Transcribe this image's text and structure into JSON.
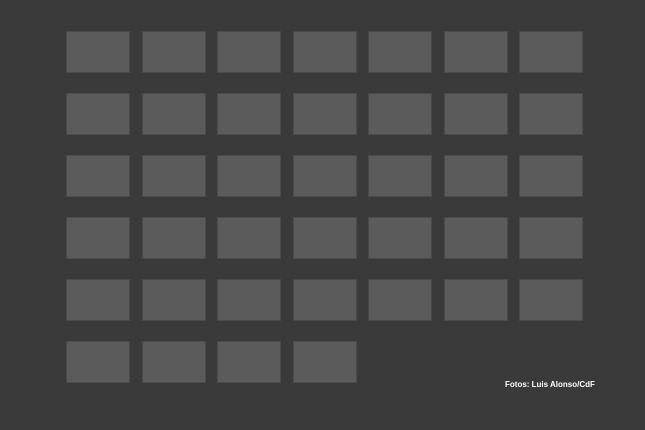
{
  "credit": "Fotos: Luis Alonso/CdF",
  "grid": {
    "rows": [
      [
        {
          "caption": "",
          "credit": ""
        },
        {
          "caption": "",
          "credit": ""
        },
        {
          "caption": "",
          "credit": ""
        },
        {
          "caption": "",
          "credit": ""
        },
        {
          "caption": "",
          "credit": ""
        },
        {
          "caption": "",
          "credit": ""
        },
        {
          "caption": "",
          "credit": ""
        }
      ],
      [
        {
          "caption": "",
          "credit": ""
        },
        {
          "caption": "",
          "credit": ""
        },
        {
          "caption": "",
          "credit": ""
        },
        {
          "caption": "",
          "credit": ""
        },
        {
          "caption": "",
          "credit": ""
        },
        {
          "caption": "",
          "credit": ""
        },
        {
          "caption": "",
          "credit": ""
        }
      ],
      [
        {
          "caption": "",
          "credit": ""
        },
        {
          "caption": "",
          "credit": ""
        },
        {
          "caption": "",
          "credit": ""
        },
        {
          "caption": "",
          "credit": ""
        },
        {
          "caption": "",
          "credit": ""
        },
        {
          "caption": "",
          "credit": ""
        },
        {
          "caption": "",
          "credit": ""
        }
      ],
      [
        {
          "caption": "",
          "credit": ""
        },
        {
          "caption": "",
          "credit": ""
        },
        {
          "caption": "",
          "credit": ""
        },
        {
          "caption": "",
          "credit": ""
        },
        {
          "caption": "",
          "credit": ""
        },
        {
          "caption": "",
          "credit": ""
        },
        {
          "caption": "",
          "credit": ""
        }
      ],
      [
        {
          "caption": "",
          "credit": ""
        },
        {
          "caption": "",
          "credit": ""
        },
        {
          "caption": "",
          "credit": ""
        },
        {
          "caption": "",
          "credit": ""
        },
        {
          "caption": "",
          "credit": ""
        },
        {
          "caption": "",
          "credit": ""
        },
        {
          "caption": "",
          "credit": ""
        }
      ],
      [
        {
          "caption": "",
          "credit": ""
        },
        {
          "caption": "",
          "credit": ""
        },
        {
          "caption": "",
          "credit": ""
        },
        {
          "caption": "",
          "credit": ""
        }
      ]
    ]
  }
}
